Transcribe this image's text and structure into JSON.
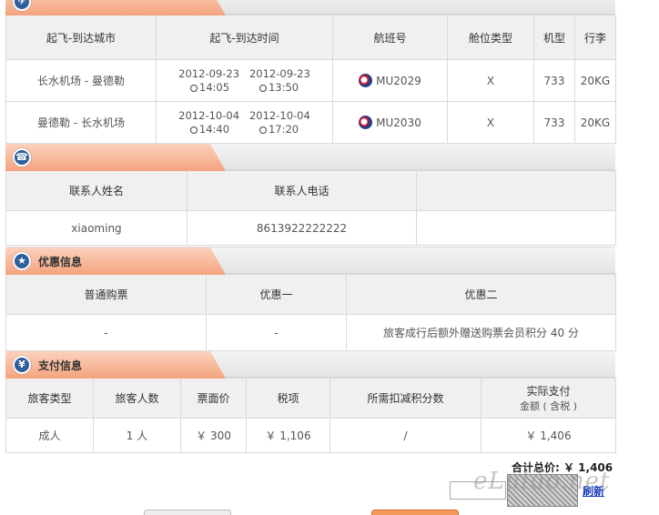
{
  "flight_section": {
    "headers": [
      "起飞-到达城市",
      "起飞-到达时间",
      "航班号",
      "舱位类型",
      "机型",
      "行李"
    ],
    "rows": [
      {
        "route": "长水机场 - 曼德勒",
        "dep_date": "2012-09-23",
        "arr_date": "2012-09-23",
        "dep_time": "14:05",
        "arr_time": "13:50",
        "flight_no": "MU2029",
        "cabin": "X",
        "aircraft": "733",
        "baggage": "20KG"
      },
      {
        "route": "曼德勒 - 长水机场",
        "dep_date": "2012-10-04",
        "arr_date": "2012-10-04",
        "dep_time": "14:40",
        "arr_time": "17:20",
        "flight_no": "MU2030",
        "cabin": "X",
        "aircraft": "733",
        "baggage": "20KG"
      }
    ]
  },
  "contact_section": {
    "headers": [
      "联系人姓名",
      "联系人电话",
      ""
    ],
    "values": [
      "xiaoming",
      "8613922222222",
      ""
    ]
  },
  "discount_section": {
    "title": "优惠信息",
    "headers": [
      "普通购票",
      "优惠一",
      "优惠二"
    ],
    "values": [
      "-",
      "-",
      "旅客成行后额外赠送购票会员积分 40 分"
    ]
  },
  "payment_section": {
    "title": "支付信息",
    "headers": [
      "旅客类型",
      "旅客人数",
      "票面价",
      "税项",
      "所需扣减积分数"
    ],
    "actual_pay_header": "实际支付",
    "actual_pay_sub": "金额 ( 含税 )",
    "values": [
      "成人",
      "1 人",
      "￥ 300",
      "￥ 1,106",
      "/",
      "￥ 1,406"
    ]
  },
  "summary": {
    "total": "合计总价: ￥ 1,406"
  },
  "verification": {
    "refresh_label": "刷新"
  },
  "watermark": "eLuluo.net",
  "colors": {
    "tab_orange": "#f4a37e",
    "icon_blue": "#2d5f9c",
    "border": "#d9d9d9"
  }
}
